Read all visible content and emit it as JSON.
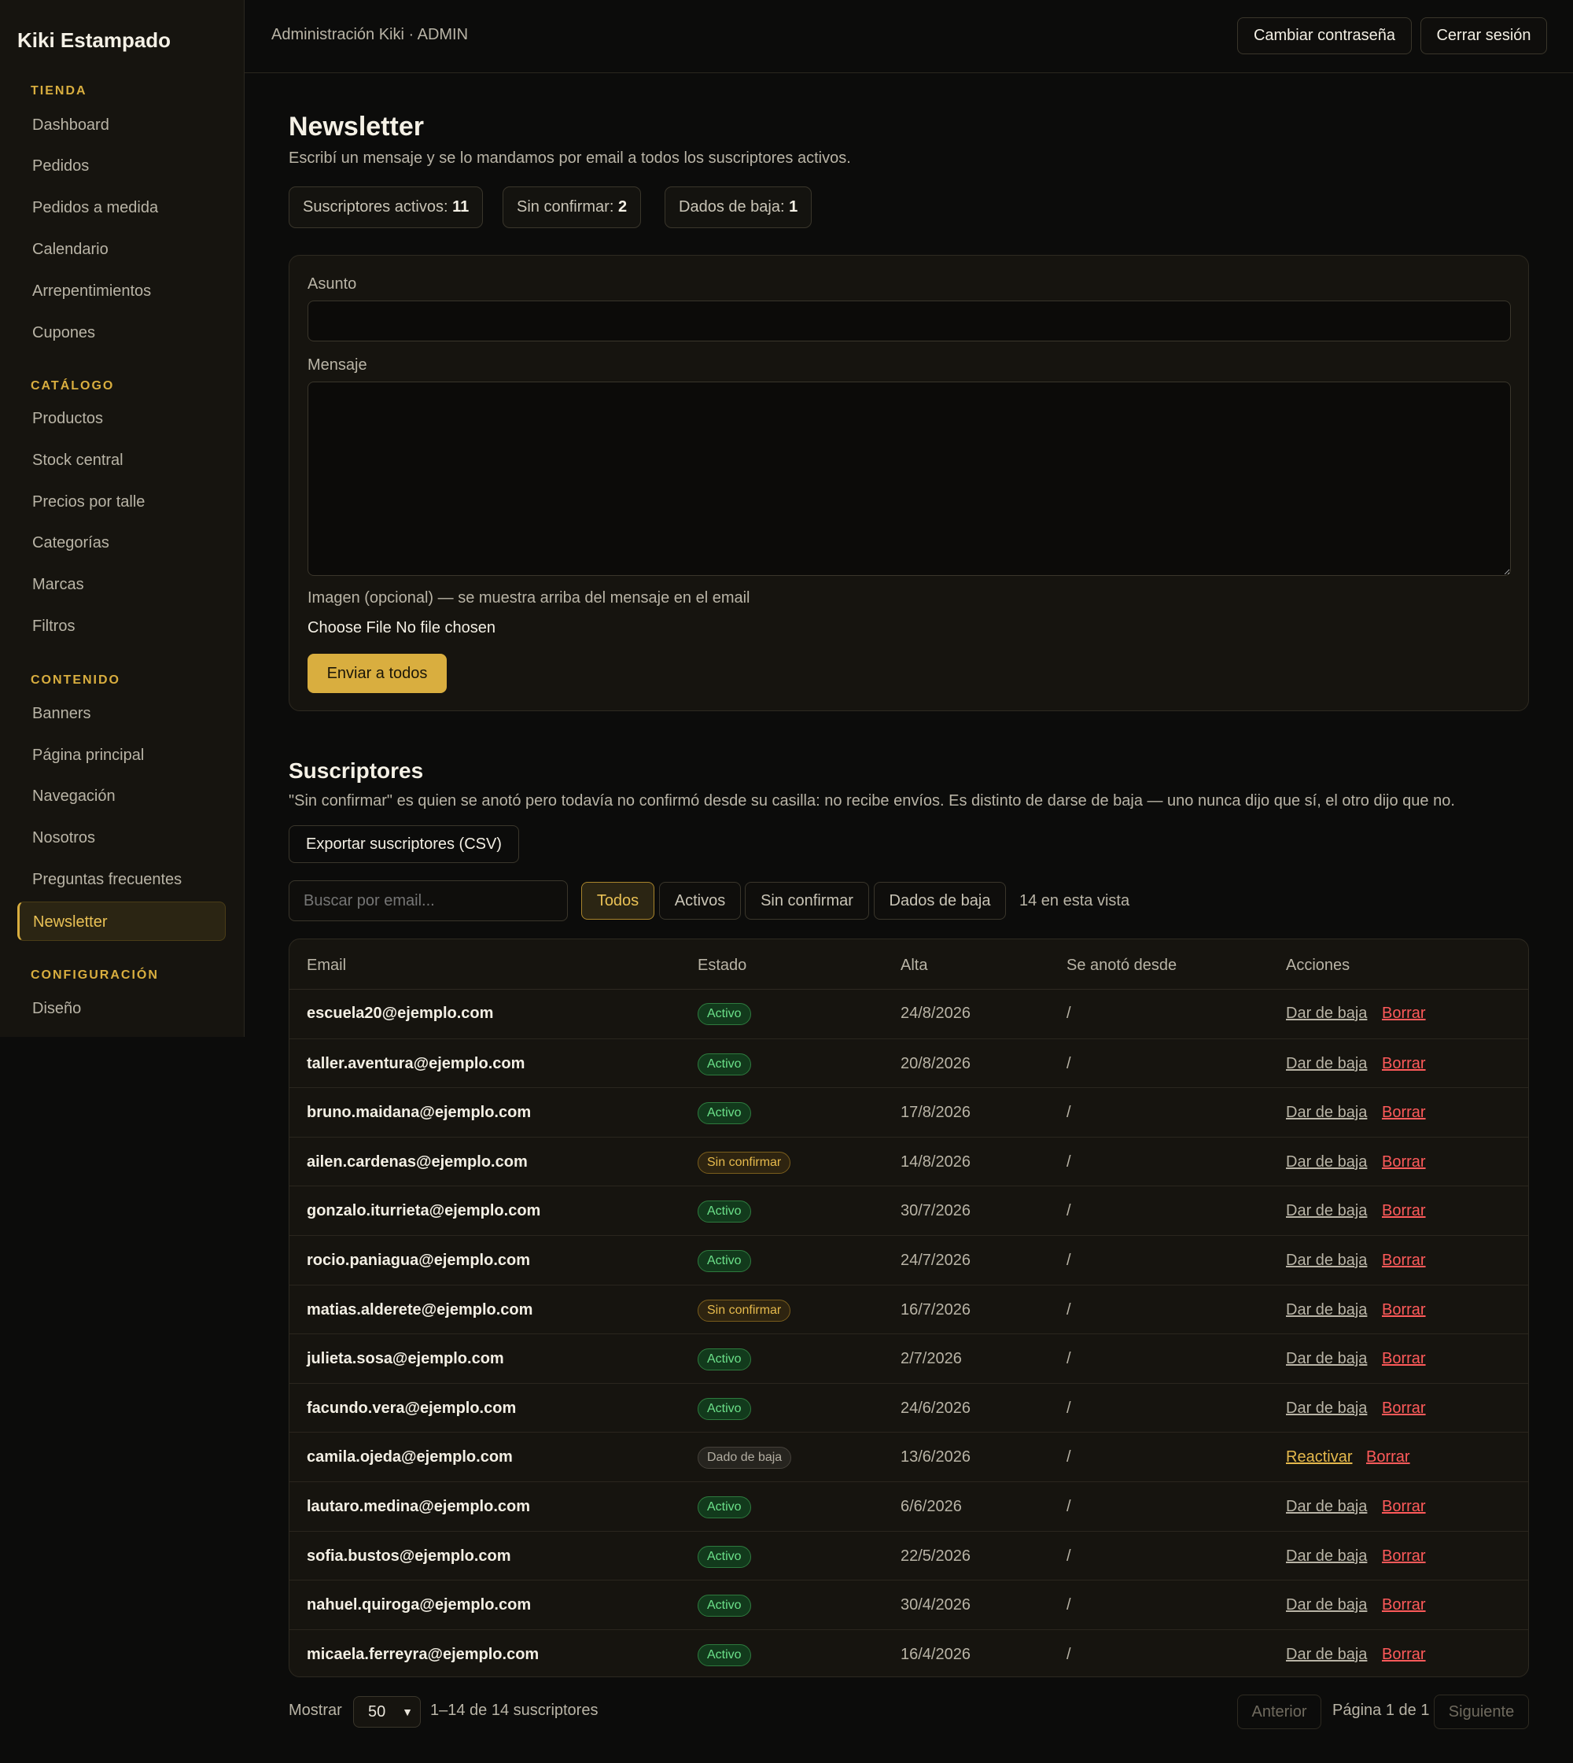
{
  "sidebar": {
    "brand": "Kiki Estampado",
    "sections": [
      {
        "title": "TIENDA",
        "items": [
          "Dashboard",
          "Pedidos",
          "Pedidos a medida",
          "Calendario",
          "Arrepentimientos",
          "Cupones"
        ]
      },
      {
        "title": "CATÁLOGO",
        "items": [
          "Productos",
          "Stock central",
          "Precios por talle",
          "Categorías",
          "Marcas",
          "Filtros"
        ]
      },
      {
        "title": "CONTENIDO",
        "items": [
          "Banners",
          "Página principal",
          "Navegación",
          "Nosotros",
          "Preguntas frecuentes",
          "Newsletter"
        ]
      },
      {
        "title": "CONFIGURACIÓN",
        "items": [
          "Diseño"
        ]
      }
    ],
    "active_item": "Newsletter"
  },
  "topbar": {
    "title": "Administración Kiki · ADMIN",
    "change_password": "Cambiar contraseña",
    "logout": "Cerrar sesión"
  },
  "page": {
    "title": "Newsletter",
    "subtitle": "Escribí un mensaje y se lo mandamos por email a todos los suscriptores activos."
  },
  "stats": [
    {
      "label": "Suscriptores activos:",
      "value": "11"
    },
    {
      "label": "Sin confirmar:",
      "value": "2"
    },
    {
      "label": "Dados de baja:",
      "value": "1"
    }
  ],
  "compose": {
    "subject_label": "Asunto",
    "subject_value": "",
    "message_label": "Mensaje",
    "message_value": "",
    "image_label": "Imagen (opcional) — se muestra arriba del mensaje en el email",
    "file_button": "Choose File",
    "file_status": "No file chosen",
    "send_button": "Enviar a todos"
  },
  "subscribers": {
    "title": "Suscriptores",
    "note": "\"Sin confirmar\" es quien se anotó pero todavía no confirmó desde su casilla: no recibe envíos. Es distinto de darse de baja — uno nunca dijo que sí, el otro dijo que no.",
    "export_button": "Exportar suscriptores (CSV)",
    "search_placeholder": "Buscar por email...",
    "filters": [
      "Todos",
      "Activos",
      "Sin confirmar",
      "Dados de baja"
    ],
    "active_filter": "Todos",
    "view_count": "14 en esta vista",
    "columns": [
      "Email",
      "Estado",
      "Alta",
      "Se anotó desde",
      "Acciones"
    ],
    "rows": [
      {
        "email": "escuela20@ejemplo.com",
        "status": "Activo",
        "date": "24/8/2026",
        "from": "/",
        "action": "Dar de baja",
        "delete": "Borrar"
      },
      {
        "email": "taller.aventura@ejemplo.com",
        "status": "Activo",
        "date": "20/8/2026",
        "from": "/",
        "action": "Dar de baja",
        "delete": "Borrar"
      },
      {
        "email": "bruno.maidana@ejemplo.com",
        "status": "Activo",
        "date": "17/8/2026",
        "from": "/",
        "action": "Dar de baja",
        "delete": "Borrar"
      },
      {
        "email": "ailen.cardenas@ejemplo.com",
        "status": "Sin confirmar",
        "date": "14/8/2026",
        "from": "/",
        "action": "Dar de baja",
        "delete": "Borrar"
      },
      {
        "email": "gonzalo.iturrieta@ejemplo.com",
        "status": "Activo",
        "date": "30/7/2026",
        "from": "/",
        "action": "Dar de baja",
        "delete": "Borrar"
      },
      {
        "email": "rocio.paniagua@ejemplo.com",
        "status": "Activo",
        "date": "24/7/2026",
        "from": "/",
        "action": "Dar de baja",
        "delete": "Borrar"
      },
      {
        "email": "matias.alderete@ejemplo.com",
        "status": "Sin confirmar",
        "date": "16/7/2026",
        "from": "/",
        "action": "Dar de baja",
        "delete": "Borrar"
      },
      {
        "email": "julieta.sosa@ejemplo.com",
        "status": "Activo",
        "date": "2/7/2026",
        "from": "/",
        "action": "Dar de baja",
        "delete": "Borrar"
      },
      {
        "email": "facundo.vera@ejemplo.com",
        "status": "Activo",
        "date": "24/6/2026",
        "from": "/",
        "action": "Dar de baja",
        "delete": "Borrar"
      },
      {
        "email": "camila.ojeda@ejemplo.com",
        "status": "Dado de baja",
        "date": "13/6/2026",
        "from": "/",
        "action": "Reactivar",
        "delete": "Borrar"
      },
      {
        "email": "lautaro.medina@ejemplo.com",
        "status": "Activo",
        "date": "6/6/2026",
        "from": "/",
        "action": "Dar de baja",
        "delete": "Borrar"
      },
      {
        "email": "sofia.bustos@ejemplo.com",
        "status": "Activo",
        "date": "22/5/2026",
        "from": "/",
        "action": "Dar de baja",
        "delete": "Borrar"
      },
      {
        "email": "nahuel.quiroga@ejemplo.com",
        "status": "Activo",
        "date": "30/4/2026",
        "from": "/",
        "action": "Dar de baja",
        "delete": "Borrar"
      },
      {
        "email": "micaela.ferreyra@ejemplo.com",
        "status": "Activo",
        "date": "16/4/2026",
        "from": "/",
        "action": "Dar de baja",
        "delete": "Borrar"
      }
    ]
  },
  "pagination": {
    "show_label": "Mostrar",
    "page_size": "50",
    "range": "1–14 de 14 suscriptores",
    "prev": "Anterior",
    "page_info": "Página 1 de 1",
    "next": "Siguiente"
  },
  "colors": {
    "accent": "#d9ae3f",
    "danger": "#ff5a5a",
    "success": "#6be089"
  }
}
